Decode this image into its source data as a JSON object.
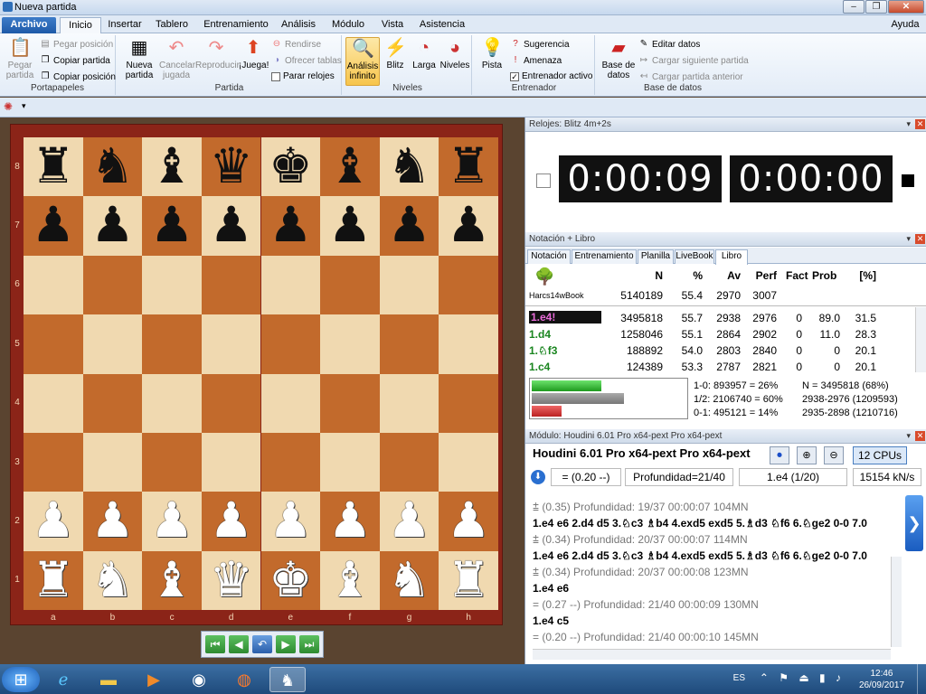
{
  "window": {
    "title": "Nueva partida",
    "help": "Ayuda"
  },
  "menu_tabs": [
    "Archivo",
    "Inicio",
    "Insertar",
    "Tablero",
    "Entrenamiento",
    "Análisis",
    "Módulo",
    "Vista",
    "Asistencia"
  ],
  "ribbon": {
    "portapapeles": {
      "label": "Portapapeles",
      "pegar": "Pegar\npartida",
      "pegar_posicion": "Pegar posición",
      "copiar_partida": "Copiar partida",
      "copiar_posicion": "Copiar posición"
    },
    "partida": {
      "label": "Partida",
      "nueva": "Nueva\npartida",
      "cancelar": "Cancelar\njugada",
      "reproducir": "Reproducir",
      "juega": "¡Juega!",
      "rendirse": "Rendirse",
      "ofrecer_tablas": "Ofrecer tablas",
      "parar_relojes": "Parar relojes"
    },
    "niveles": {
      "label": "Niveles",
      "analisis": "Análisis\ninfinito",
      "blitz": "Blitz",
      "larga": "Larga",
      "niveles": "Niveles"
    },
    "entrenador": {
      "label": "Entrenador",
      "pista": "Pista",
      "sugerencia": "Sugerencia",
      "amenaza": "Amenaza",
      "entrenador_activo": "Entrenador activo"
    },
    "base": {
      "label": "Base de datos",
      "base": "Base de\ndatos",
      "editar": "Editar datos",
      "cargar_siguiente": "Cargar siguiente partida",
      "cargar_anterior": "Cargar partida anterior"
    }
  },
  "board": {
    "ranks": [
      "8",
      "7",
      "6",
      "5",
      "4",
      "3",
      "2",
      "1"
    ],
    "files": [
      "a",
      "b",
      "c",
      "d",
      "e",
      "f",
      "g",
      "h"
    ],
    "position": [
      [
        "♜",
        "♞",
        "♝",
        "♛",
        "♚",
        "♝",
        "♞",
        "♜"
      ],
      [
        "♟",
        "♟",
        "♟",
        "♟",
        "♟",
        "♟",
        "♟",
        "♟"
      ],
      [
        "",
        "",
        "",
        "",
        "",
        "",
        "",
        ""
      ],
      [
        "",
        "",
        "",
        "",
        "",
        "",
        "",
        ""
      ],
      [
        "",
        "",
        "",
        "",
        "",
        "",
        "",
        ""
      ],
      [
        "",
        "",
        "",
        "",
        "",
        "",
        "",
        ""
      ],
      [
        "♟",
        "♟",
        "♟",
        "♟",
        "♟",
        "♟",
        "♟",
        "♟"
      ],
      [
        "♜",
        "♞",
        "♝",
        "♛",
        "♚",
        "♝",
        "♞",
        "♜"
      ]
    ]
  },
  "clocks": {
    "header": "Relojes: Blitz 4m+2s",
    "white": "0:00:09",
    "black": "0:00:00"
  },
  "notation": {
    "header": "Notación + Libro",
    "tabs": [
      "Notación",
      "Entrenamiento",
      "Planilla",
      "LiveBook",
      "Libro"
    ],
    "columns": {
      "n": "N",
      "pct": "%",
      "av": "Av",
      "perf": "Perf",
      "fact": "Fact",
      "prob": "Prob",
      "pc": "[%]"
    },
    "book": {
      "name": "Harcs14wBook",
      "n": "5140189",
      "pct": "55.4",
      "av": "2970",
      "perf": "3007"
    },
    "rows": [
      {
        "move": "1.e4!",
        "n": "3495818",
        "pct": "55.7",
        "av": "2938",
        "perf": "2976",
        "fact": "0",
        "prob": "89.0",
        "pc": "31.5"
      },
      {
        "move": "1.d4",
        "n": "1258046",
        "pct": "55.1",
        "av": "2864",
        "perf": "2902",
        "fact": "0",
        "prob": "11.0",
        "pc": "28.3"
      },
      {
        "move": "1.♘f3",
        "n": "188892",
        "pct": "54.0",
        "av": "2803",
        "perf": "2840",
        "fact": "0",
        "prob": "0",
        "pc": "20.1"
      },
      {
        "move": "1.c4",
        "n": "124389",
        "pct": "53.3",
        "av": "2787",
        "perf": "2821",
        "fact": "0",
        "prob": "0",
        "pc": "20.1"
      }
    ],
    "stats": {
      "white": "1-0: 893957 = 26%",
      "draw": "1/2: 2106740 = 60%",
      "black": "0-1: 495121 = 14%",
      "n": "N = 3495818 (68%)",
      "r1": "2938-2976 (1209593)",
      "r2": "2935-2898 (1210716)",
      "white_frac": 0.26,
      "draw_frac": 0.6,
      "black_frac": 0.14
    }
  },
  "engine": {
    "header": "Módulo: Houdini 6.01 Pro x64-pext  Pro x64-pext",
    "name": "Houdini 6.01 Pro x64-pext  Pro x64-pext",
    "cpus": "12 CPUs",
    "eval": "= (0.20 --)",
    "depth": "Profundidad=21/40",
    "move": "1.e4 (1/20)",
    "speed": "15154 kN/s",
    "lines": [
      {
        "meta": "⩲ (0.35)  Profundidad: 19/37  00:00:07  104MN",
        "moves": "1.e4 e6 2.d4 d5 3.♘c3 ♗b4 4.exd5 exd5 5.♗d3 ♘f6 6.♘ge2 0-0 7.0"
      },
      {
        "meta": "⩲ (0.34)  Profundidad: 20/37  00:00:07  114MN",
        "moves": "1.e4 e6 2.d4 d5 3.♘c3 ♗b4 4.exd5 exd5 5.♗d3 ♘f6 6.♘ge2 0-0 7.0"
      },
      {
        "meta": "⩲ (0.34)  Profundidad: 20/37  00:00:08  123MN",
        "moves": "1.e4 e6"
      },
      {
        "meta": "= (0.27 --)  Profundidad: 21/40  00:00:09  130MN",
        "moves": "1.e4 c5"
      },
      {
        "meta": "= (0.20 --)  Profundidad: 21/40  00:00:10  145MN",
        "moves": ""
      }
    ]
  },
  "taskbar": {
    "lang": "ES",
    "time": "12:46",
    "date": "26/09/2017"
  }
}
